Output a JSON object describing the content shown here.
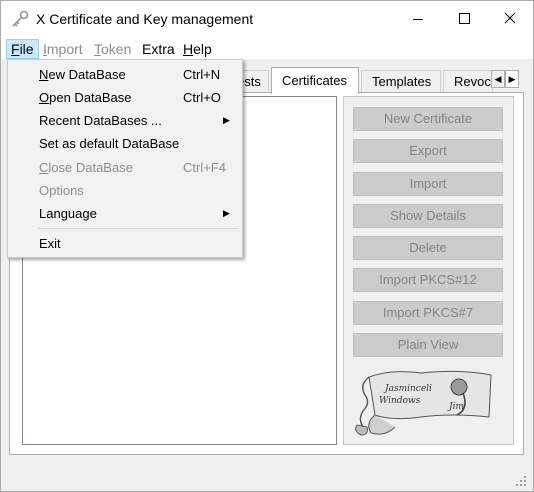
{
  "window": {
    "title": "X Certificate and Key management",
    "icon": "key-app-icon"
  },
  "menubar": {
    "items": [
      {
        "label_pre": "",
        "label_ul": "F",
        "label_post": "ile",
        "state": "active"
      },
      {
        "label_pre": "",
        "label_ul": "I",
        "label_post": "mport",
        "state": "disabled"
      },
      {
        "label_pre": "",
        "label_ul": "T",
        "label_post": "oken",
        "state": "disabled"
      },
      {
        "label_pre": "",
        "label_ul": "",
        "label_post": "Extra",
        "state": "normal"
      },
      {
        "label_pre": "",
        "label_ul": "H",
        "label_post": "elp",
        "state": "normal"
      }
    ]
  },
  "file_menu": {
    "items": [
      {
        "ul": "N",
        "rest": "ew DataBase",
        "shortcut": "Ctrl+N",
        "enabled": true,
        "submenu": false
      },
      {
        "ul": "O",
        "rest": "pen DataBase",
        "shortcut": "Ctrl+O",
        "enabled": true,
        "submenu": false
      },
      {
        "ul": "",
        "rest": "Recent DataBases ...",
        "shortcut": "",
        "enabled": true,
        "submenu": true
      },
      {
        "ul": "",
        "rest": "Set as default DataBase",
        "shortcut": "",
        "enabled": true,
        "submenu": false
      },
      {
        "ul": "C",
        "rest": "lose DataBase",
        "shortcut": "Ctrl+F4",
        "enabled": false,
        "submenu": false
      },
      {
        "ul": "",
        "rest": "Options",
        "shortcut": "",
        "enabled": false,
        "submenu": false
      },
      {
        "ul": "",
        "rest": "Language",
        "shortcut": "",
        "enabled": true,
        "submenu": true
      },
      {
        "ul": "",
        "rest": "Exit",
        "shortcut": "",
        "enabled": true,
        "submenu": false
      }
    ]
  },
  "tabs": {
    "partial_left": "ests",
    "certificates": "Certificates",
    "templates": "Templates",
    "partial_right": "Revoca"
  },
  "actions": {
    "new_certificate": "New Certificate",
    "export": "Export",
    "import": "Import",
    "show_details": "Show Details",
    "delete": "Delete",
    "import_pkcs12": "Import PKCS#12",
    "import_pkcs7": "Import PKCS#7",
    "plain_view": "Plain View"
  },
  "scroll_image": {
    "line1": "Jasminceli",
    "line2": "Windows",
    "line3": "Jim"
  },
  "colors": {
    "menu_highlight": "#cce8ff",
    "disabled_text": "#838383",
    "button_disabled_bg": "#cccccc"
  }
}
